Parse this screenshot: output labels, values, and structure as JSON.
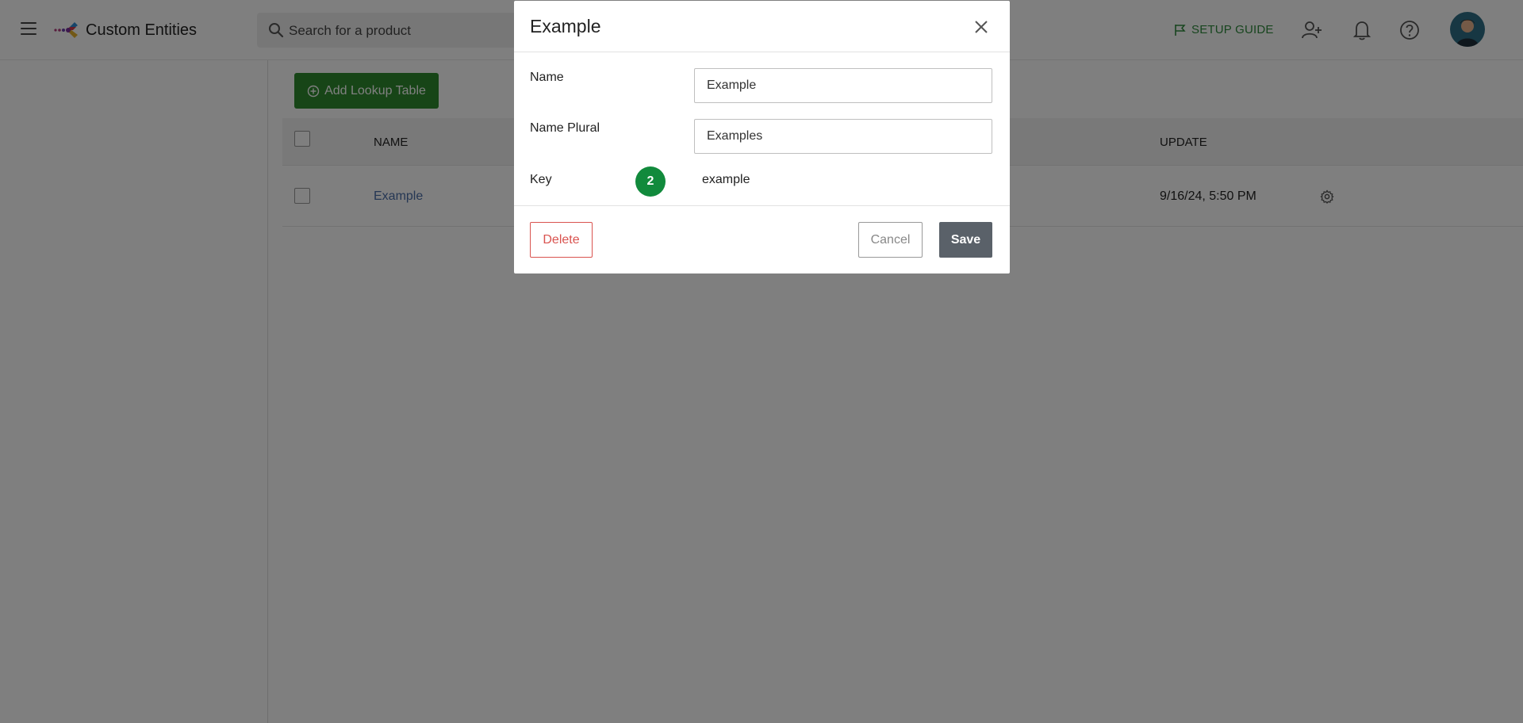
{
  "header": {
    "app_title": "Custom Entities",
    "search_placeholder": "Search for a product",
    "setup_guide_label": "SETUP GUIDE",
    "icons": [
      "menu-icon",
      "app-logo",
      "search-icon",
      "flag-icon",
      "add-user-icon",
      "bell-icon",
      "help-icon",
      "avatar"
    ]
  },
  "toolbar": {
    "add_lookup_label": "Add Lookup Table"
  },
  "table": {
    "columns": [
      "NAME",
      "UPDATE"
    ],
    "rows": [
      {
        "name": "Example",
        "update": "9/16/24, 5:50 PM"
      }
    ]
  },
  "modal": {
    "title": "Example",
    "name_label": "Name",
    "name_value": "Example",
    "name_plural_label": "Name Plural",
    "name_plural_value": "Examples",
    "key_label": "Key",
    "key_value": "example",
    "step_badge": "2",
    "delete_label": "Delete",
    "cancel_label": "Cancel",
    "save_label": "Save"
  },
  "colors": {
    "primary_green": "#2e8b2e",
    "badge_green": "#118a3c",
    "danger_red": "#d9534f",
    "save_gray": "#5a6169",
    "link_blue": "#4a6ea8"
  }
}
